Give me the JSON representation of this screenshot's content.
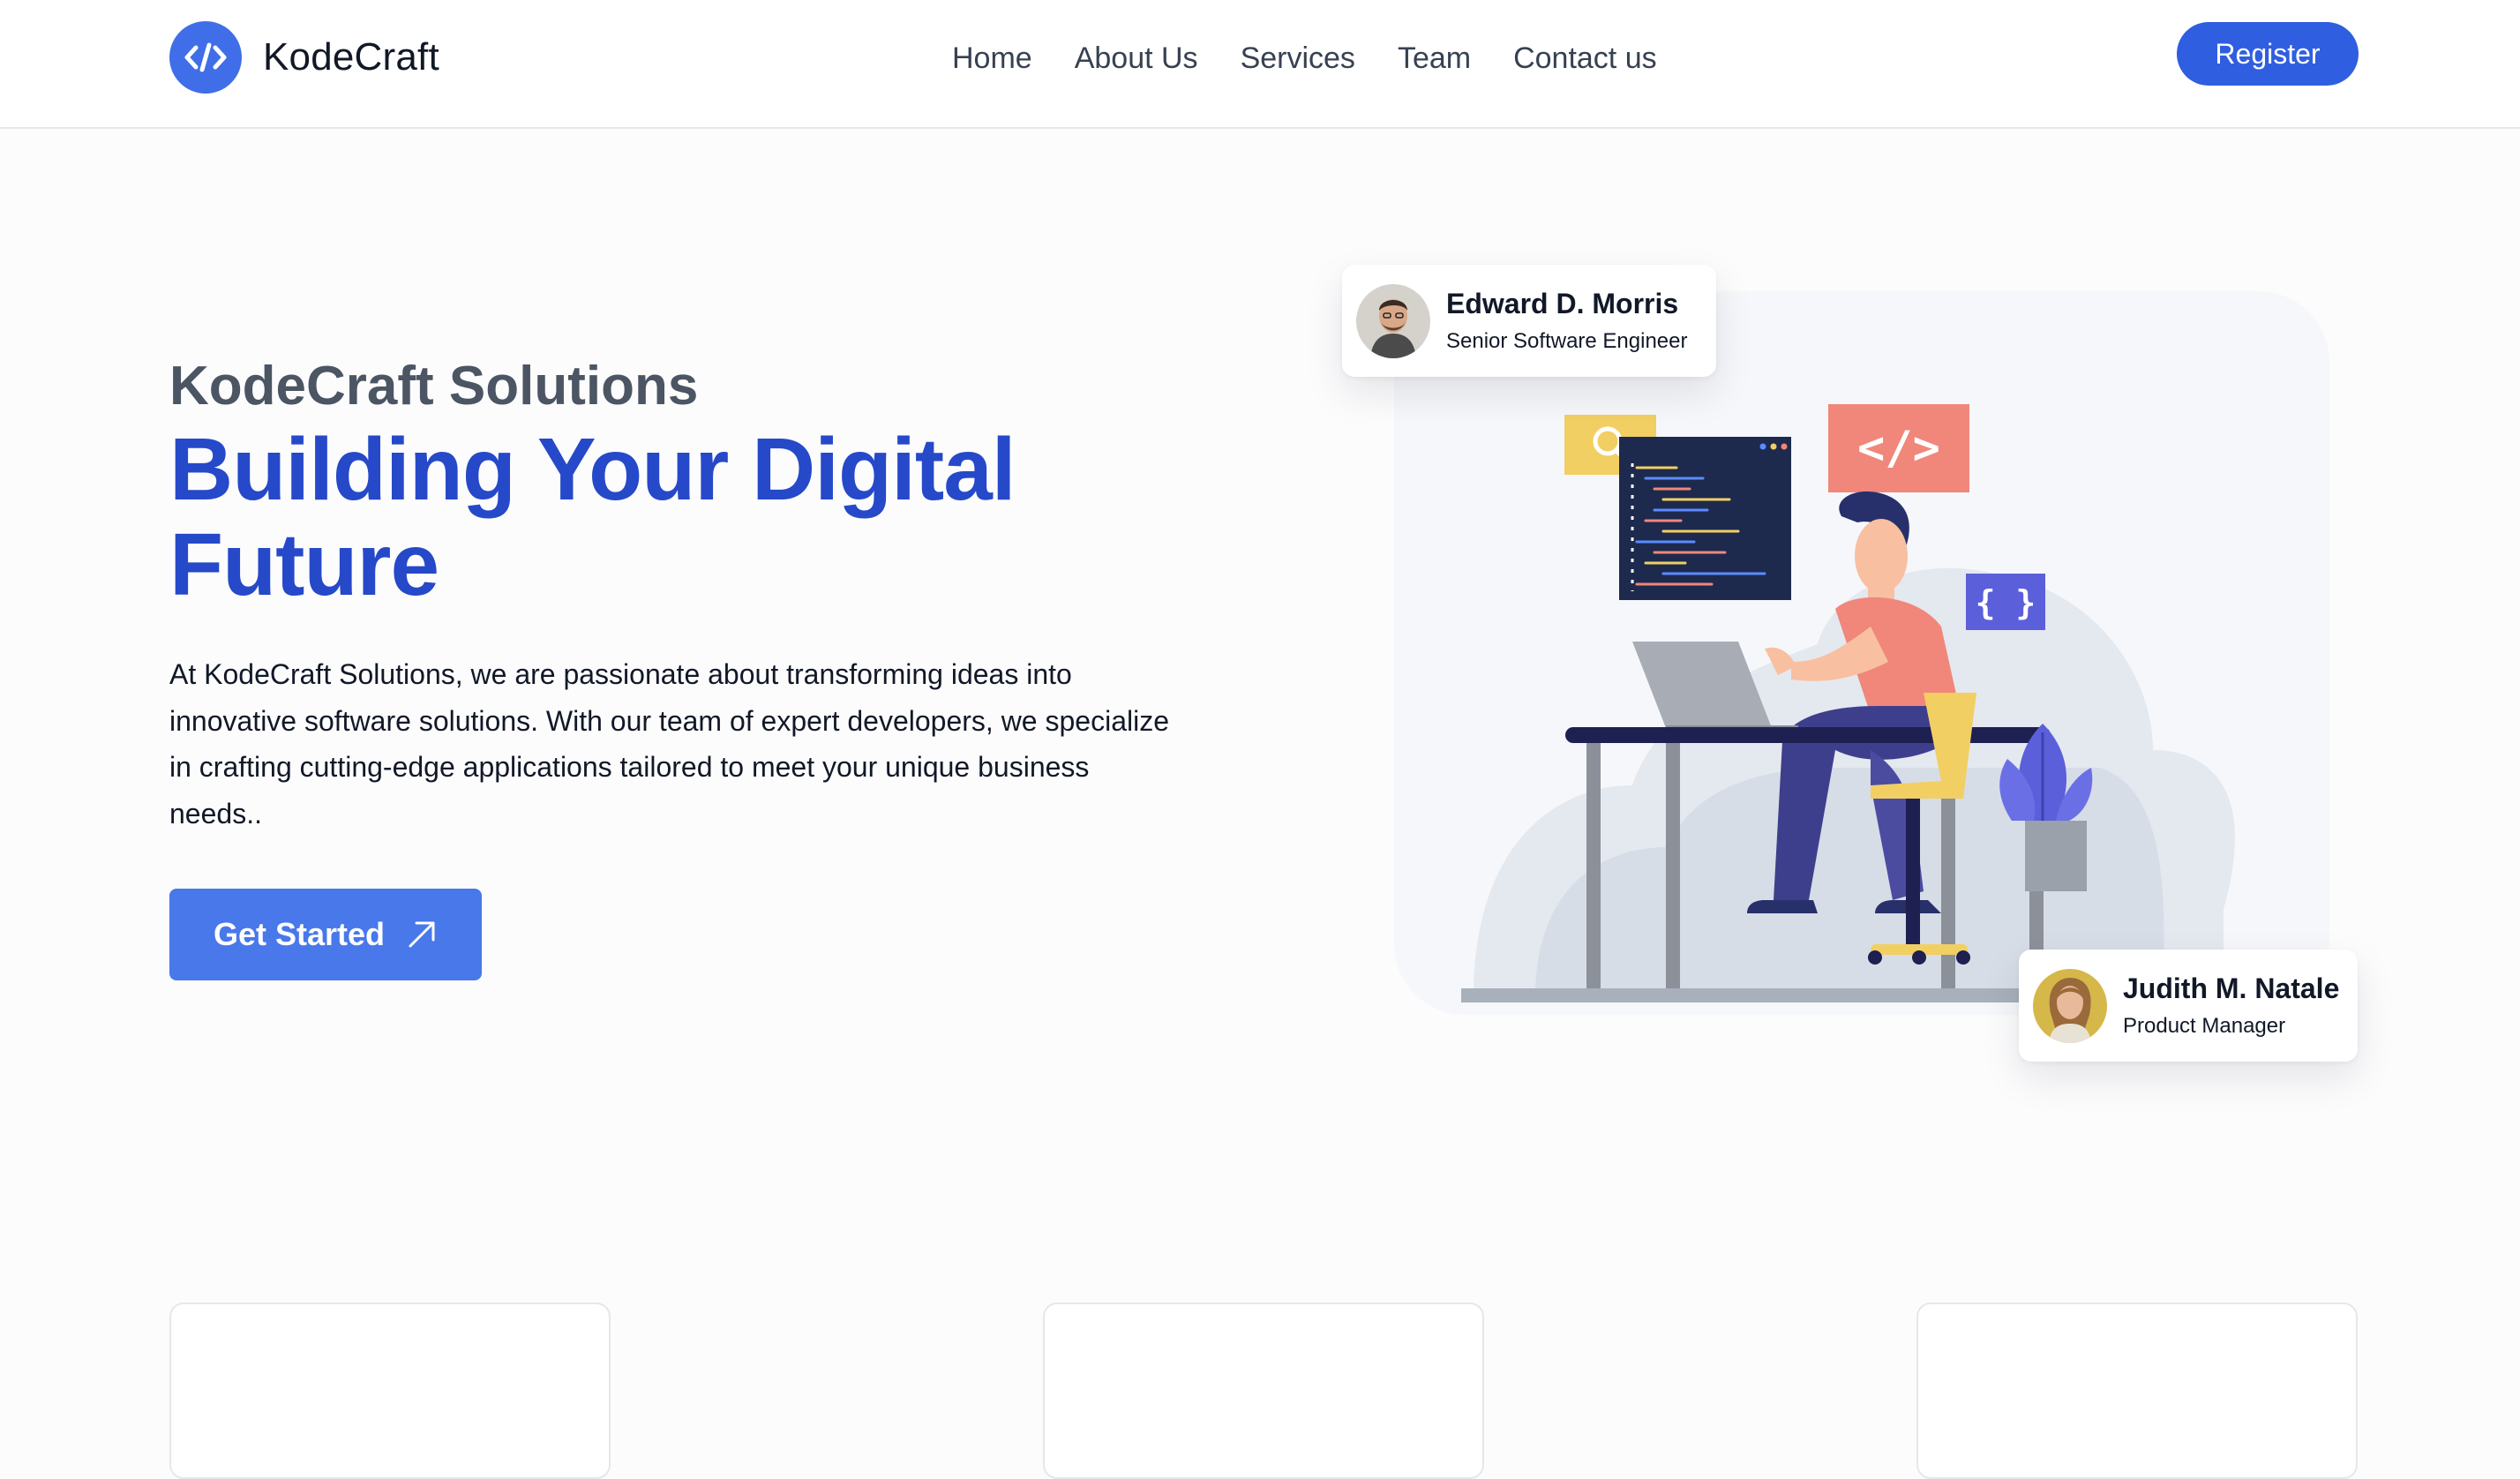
{
  "brand": {
    "name": "KodeCraft",
    "logo_icon": "code-icon",
    "accent": "#3f6ee8"
  },
  "nav": {
    "links": [
      {
        "label": "Home"
      },
      {
        "label": "About Us"
      },
      {
        "label": "Services"
      },
      {
        "label": "Team"
      },
      {
        "label": "Contact us"
      }
    ],
    "register_label": "Register"
  },
  "hero": {
    "eyebrow": "KodeCraft Solutions",
    "title_line1": "Building Your Digital",
    "title_line2": "Future",
    "description": "At KodeCraft Solutions, we are passionate about transforming ideas into innovative software solutions. With our team of expert developers, we specialize in crafting cutting-edge applications tailored to meet your unique business needs..",
    "cta_label": "Get Started",
    "cta_icon": "arrow-up-right-icon",
    "title_color": "#2649c9"
  },
  "illustration": {
    "icons": [
      "search-icon",
      "code-tag-icon",
      "curly-braces-icon"
    ],
    "code_symbol": "</>",
    "braces_symbol": "{ }"
  },
  "profiles": [
    {
      "name": "Edward D. Morris",
      "role": "Senior Software Engineer"
    },
    {
      "name": "Judith M. Natale",
      "role": "Product Manager"
    }
  ],
  "colors": {
    "primary": "#2f5ee0",
    "cta": "#4878ea",
    "illustration_orange": "#f0877a",
    "illustration_yellow": "#f2cf63",
    "illustration_purple": "#5b5fd9"
  }
}
